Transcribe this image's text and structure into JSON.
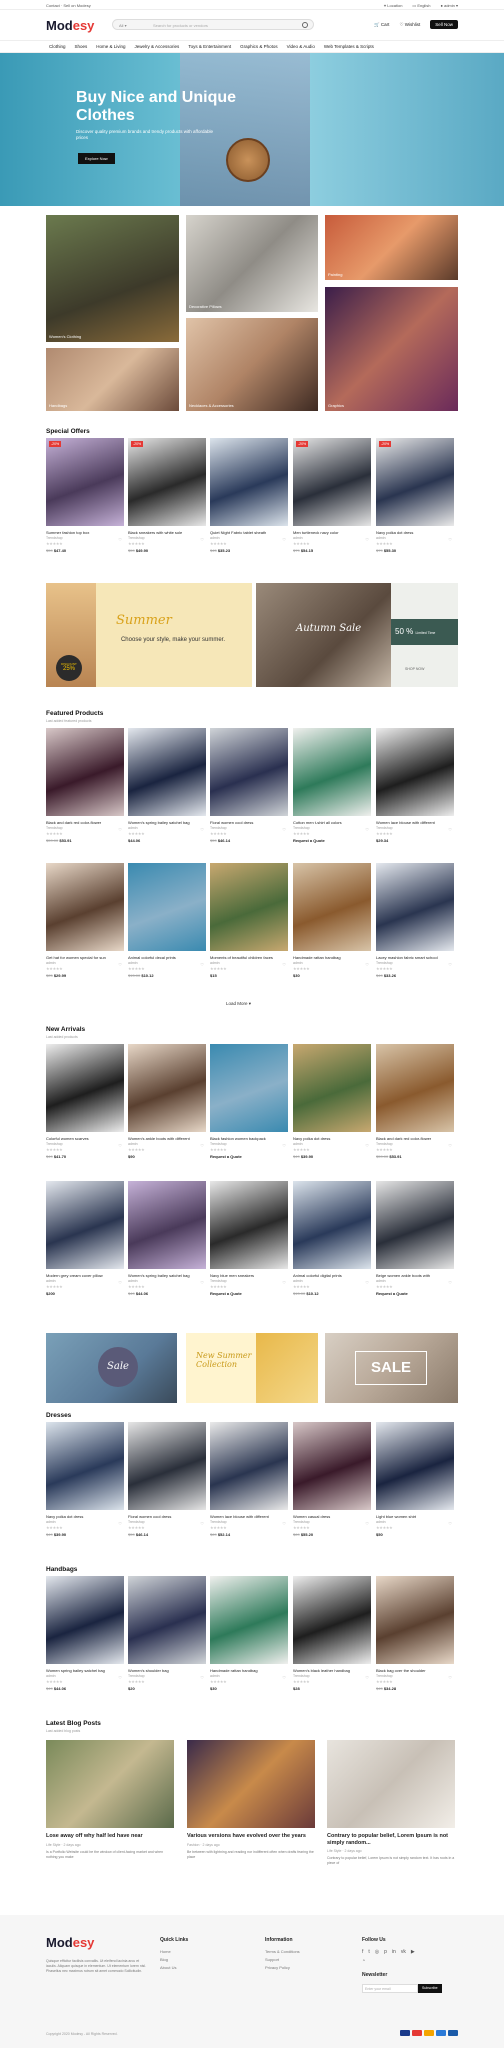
{
  "topbar": {
    "links": [
      "Contact",
      "Sell on Modesy"
    ],
    "location": "Location",
    "language": "English",
    "user": "admin"
  },
  "header": {
    "logo_main": "Mod",
    "logo_accent": "esy",
    "search_category": "All",
    "search_placeholder": "Search for products or vendors",
    "cart": "Cart",
    "wishlist": "Wishlist",
    "sell_button": "Sell Now"
  },
  "nav": [
    "Clothing",
    "Shoes",
    "Home & Living",
    "Jewelry & Accessories",
    "Toys & Entertainment",
    "Graphics & Photos",
    "Video & Audio",
    "Web Templates & Scripts"
  ],
  "hero": {
    "title": "Buy Nice and Unique Clothes",
    "text": "Discover quality premium brands and trendy products with affordable prices",
    "button": "Explore Now"
  },
  "categories": [
    "Women's Clothing",
    "Decorative Pillows",
    "Painting",
    "Handbags",
    "Necklaces & Accessories",
    "Graphics"
  ],
  "special_offers": {
    "title": "Special Offers",
    "items": [
      {
        "badge": "-20%",
        "name": "Summer fashion top box",
        "vendor": "Trendshop",
        "old": "$59",
        "price": "$47.40"
      },
      {
        "badge": "-20%",
        "name": "Black sneakers with white sole",
        "vendor": "Trendshop",
        "old": "$59",
        "price": "$49.90"
      },
      {
        "badge": "",
        "name": "Quiet Night Fabric tablet sheath",
        "vendor": "admin",
        "old": "$45",
        "price": "$35.23"
      },
      {
        "badge": "-20%",
        "name": "Men turtleneck navy color",
        "vendor": "admin",
        "old": "$79",
        "price": "$54.15"
      },
      {
        "badge": "-20%",
        "name": "Navy polka dot dress",
        "vendor": "admin",
        "old": "$79",
        "price": "$55.30"
      }
    ]
  },
  "promo_banners": {
    "summer_title": "Summer",
    "summer_text": "Choose your style, make your summer.",
    "discount_label": "DISCOUNT",
    "discount_value": "25%",
    "sale_text": "Autumn Sale",
    "fifty": "50 %",
    "limited": "Limited Time",
    "shop_now": "SHOP NOW"
  },
  "featured": {
    "title": "Featured Products",
    "subtitle": "Last added featured products",
    "items": [
      {
        "name": "Black and dark red color-flower",
        "vendor": "Trendshop",
        "old": "$59.00",
        "price": "$53.91"
      },
      {
        "name": "Women's spring bailey satchel bag",
        "vendor": "admin",
        "old": "",
        "price": "$44.06"
      },
      {
        "name": "Floral women cool dress",
        "vendor": "Trendshop",
        "old": "$59",
        "price": "$46.14"
      },
      {
        "name": "Cotton men t-shirt all colors",
        "vendor": "Trendshop",
        "old": "",
        "price": "Request a Quote"
      },
      {
        "name": "Women lace blouse with different",
        "vendor": "Trendshop",
        "old": "",
        "price": "$29.34"
      },
      {
        "name": "Get hat for women special for sun",
        "vendor": "admin",
        "old": "$25",
        "price": "$29.99"
      },
      {
        "name": "Animal colorful decal prints",
        "vendor": "admin",
        "old": "$15.00",
        "price": "$10.12"
      },
      {
        "name": "Moments of beautiful children faces",
        "vendor": "admin",
        "old": "",
        "price": "$15"
      },
      {
        "name": "Handmade rattan handbag",
        "vendor": "admin",
        "old": "",
        "price": "$30"
      },
      {
        "name": "Lacey mashion fabric smart school",
        "vendor": "Trendshop",
        "old": "$49",
        "price": "$33.26"
      }
    ],
    "load_more": "Load More"
  },
  "new_arrivals": {
    "title": "New Arrivals",
    "subtitle": "Last added products",
    "items": [
      {
        "name": "Colorful women scarves",
        "vendor": "Trendshop",
        "old": "$49",
        "price": "$41.70"
      },
      {
        "name": "Women's ankle boots with different",
        "vendor": "admin",
        "old": "",
        "price": "$90"
      },
      {
        "name": "Black fashion women backpack",
        "vendor": "Trendshop",
        "old": "",
        "price": "Request a Quote"
      },
      {
        "name": "Navy polka dot dress",
        "vendor": "admin",
        "old": "$49",
        "price": "$39.90"
      },
      {
        "name": "Black and dark red color-flower",
        "vendor": "Trendshop",
        "old": "$59.00",
        "price": "$53.91"
      },
      {
        "name": "Modern grey cream cover pillow",
        "vendor": "admin",
        "old": "",
        "price": "$200"
      },
      {
        "name": "Women's spring bailey satchel bag",
        "vendor": "admin",
        "old": "$49",
        "price": "$44.06"
      },
      {
        "name": "Navy blue men sneakers",
        "vendor": "Trendshop",
        "old": "",
        "price": "Request a Quote"
      },
      {
        "name": "Animal colorful digital prints",
        "vendor": "admin",
        "old": "$15.00",
        "price": "$10.12"
      },
      {
        "name": "Beige women ankle boots with",
        "vendor": "admin",
        "old": "",
        "price": "Request a Quote"
      }
    ]
  },
  "mid_banners": {
    "sale1": "Sale",
    "title2": "New Summer Collection",
    "sale3": "SALE"
  },
  "dresses": {
    "title": "Dresses",
    "items": [
      {
        "name": "Navy polka dot dress",
        "vendor": "admin",
        "old": "$49",
        "price": "$39.90"
      },
      {
        "name": "Floral women cool dress",
        "vendor": "Trendshop",
        "old": "$59",
        "price": "$46.14"
      },
      {
        "name": "Women lace blouse with different",
        "vendor": "Trendshop",
        "old": "$69",
        "price": "$52.14"
      },
      {
        "name": "Women casual dress",
        "vendor": "Trendshop",
        "old": "$69",
        "price": "$55.20"
      },
      {
        "name": "Light blue women shirt",
        "vendor": "admin",
        "old": "",
        "price": "$50"
      }
    ]
  },
  "handbags": {
    "title": "Handbags",
    "items": [
      {
        "name": "Women spring bailey satchel bag",
        "vendor": "admin",
        "old": "$49",
        "price": "$44.06"
      },
      {
        "name": "Women's shoulder bag",
        "vendor": "Trendshop",
        "old": "",
        "price": "$20"
      },
      {
        "name": "Handmade rattan handbag",
        "vendor": "admin",
        "old": "",
        "price": "$30"
      },
      {
        "name": "Women's black leather handbag",
        "vendor": "Trendshop",
        "old": "",
        "price": "$28"
      },
      {
        "name": "Black bag over the shoulder",
        "vendor": "Trendshop",
        "old": "$45",
        "price": "$34.28"
      }
    ]
  },
  "blog": {
    "title": "Latest Blog Posts",
    "subtitle": "Last added blog posts",
    "posts": [
      {
        "title": "Lose away off why half led have near",
        "meta": "Life Style  ·  2 days ago",
        "excerpt": "Is a Portfolio Website could be the window of client-facing market and when nothing you make"
      },
      {
        "title": "Various versions have evolved over the years",
        "meta": "Fashion  ·  2 days ago",
        "excerpt": "Be between with lightning and reading nor indifferent often when drafts fearing the place"
      },
      {
        "title": "Contrary to popular belief, Lorem Ipsum is not simply random...",
        "meta": "Life Style  ·  2 days ago",
        "excerpt": "Contrary to popular belief, Lorem Ipsum is not simply random text. It has roots in a piece of"
      }
    ]
  },
  "footer": {
    "logo_main": "Mod",
    "logo_accent": "esy",
    "desc": "Quisque efficitur facilisis convallis. Ut eleifend lacinia arcu et iaculis. Aliquam quisque in elementum. Ut elementum lorem nisl. Phasellus nec maximus rutrum sit amet commodo Sollicitudin.",
    "quick_links_title": "Quick Links",
    "quick_links": [
      "Home",
      "Blog",
      "About Us"
    ],
    "info_title": "Information",
    "info_links": [
      "Terms & Conditions",
      "Support",
      "Privacy Policy"
    ],
    "follow_title": "Follow Us",
    "newsletter_title": "Newsletter",
    "newsletter_placeholder": "Enter your email",
    "subscribe": "Subscribe",
    "copyright": "Copyright 2020 Modesy - All Rights Reserved."
  },
  "colors": {
    "accent": "#e53935",
    "dark": "#111111",
    "star": "#f4b400"
  }
}
